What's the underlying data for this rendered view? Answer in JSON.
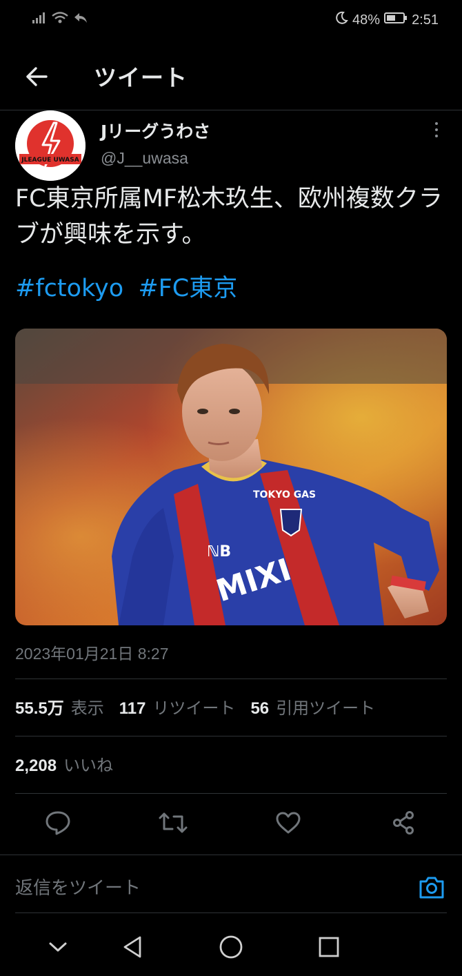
{
  "status_bar": {
    "battery": "48%",
    "time": "2:51"
  },
  "header": {
    "title": "ツイート"
  },
  "author": {
    "name": "Jリーグうわさ",
    "handle": "@J__uwasa",
    "avatar_text": "JLEAGUE UWASA"
  },
  "tweet": {
    "text": "FC東京所属MF松木玖生、欧州複数クラブが興味を示す。",
    "hashtags": [
      "#fctokyo",
      "#FC東京"
    ],
    "image_jersey_text": [
      "TOKYO GAS",
      "MIXI"
    ],
    "timestamp": "2023年01月21日 8:27"
  },
  "stats": {
    "views_count": "55.5万",
    "views_label": "表示",
    "retweets_count": "117",
    "retweets_label": "リツイート",
    "quotes_count": "56",
    "quotes_label": "引用ツイート",
    "likes_count": "2,208",
    "likes_label": "いいね"
  },
  "reply": {
    "placeholder": "返信をツイート"
  },
  "colors": {
    "background": "#000000",
    "accent": "#1d9bf0",
    "muted": "#71767b",
    "divider": "#2f3336"
  },
  "icons": [
    "signal-icon",
    "wifi-icon",
    "back-arrow-icon",
    "moon-icon",
    "battery-icon",
    "reply-icon",
    "retweet-icon",
    "like-icon",
    "share-icon",
    "camera-icon",
    "nav-down-icon",
    "nav-back-icon",
    "nav-home-icon",
    "nav-recents-icon"
  ]
}
